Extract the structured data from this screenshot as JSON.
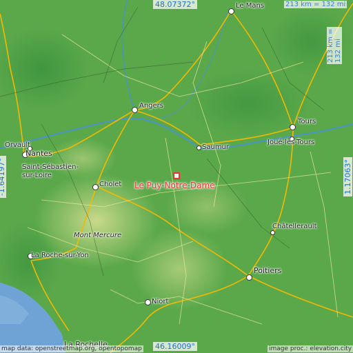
{
  "place": {
    "name": "Le Puy-Notre-Dame"
  },
  "bounds": {
    "north": "48.07372°",
    "south": "46.16009°",
    "west": "-1.64197°",
    "east": "1.17063°"
  },
  "scale": {
    "horizontal": "213 km = 132 mi",
    "vertical": "213 km = 132 mi"
  },
  "cities": [
    {
      "key": "le_mans",
      "name": "Le Mans"
    },
    {
      "key": "angers",
      "name": "Angers"
    },
    {
      "key": "tours",
      "name": "Tours"
    },
    {
      "key": "joue",
      "name": "Joué-lès-Tours"
    },
    {
      "key": "saumur",
      "name": "Saumur"
    },
    {
      "key": "orvault",
      "name": "Orvault"
    },
    {
      "key": "nantes",
      "name": "Nantes"
    },
    {
      "key": "saint_sebastien",
      "name": "Saint-Sébastien-"
    },
    {
      "key": "saint_sebastien2",
      "name": "sur-Loire"
    },
    {
      "key": "cholet",
      "name": "Cholet"
    },
    {
      "key": "mont_mercure",
      "name": "Mont Mercure"
    },
    {
      "key": "chatellerault",
      "name": "Châtellerault"
    },
    {
      "key": "la_roche",
      "name": "La Roche-sur-Yon"
    },
    {
      "key": "poitiers",
      "name": "Poitiers"
    },
    {
      "key": "niort",
      "name": "Niort"
    },
    {
      "key": "la_rochelle",
      "name": "La Rochelle"
    }
  ],
  "credits": {
    "left": "map data: openstreetmap.org, opentopomap",
    "right": "image proc.: elevation.city"
  },
  "colors": {
    "accent": "#e53935",
    "coord_text": "#1f6fd6",
    "land": "#5aa84a",
    "sea": "#6fa3d6",
    "road": "#f5b800"
  }
}
